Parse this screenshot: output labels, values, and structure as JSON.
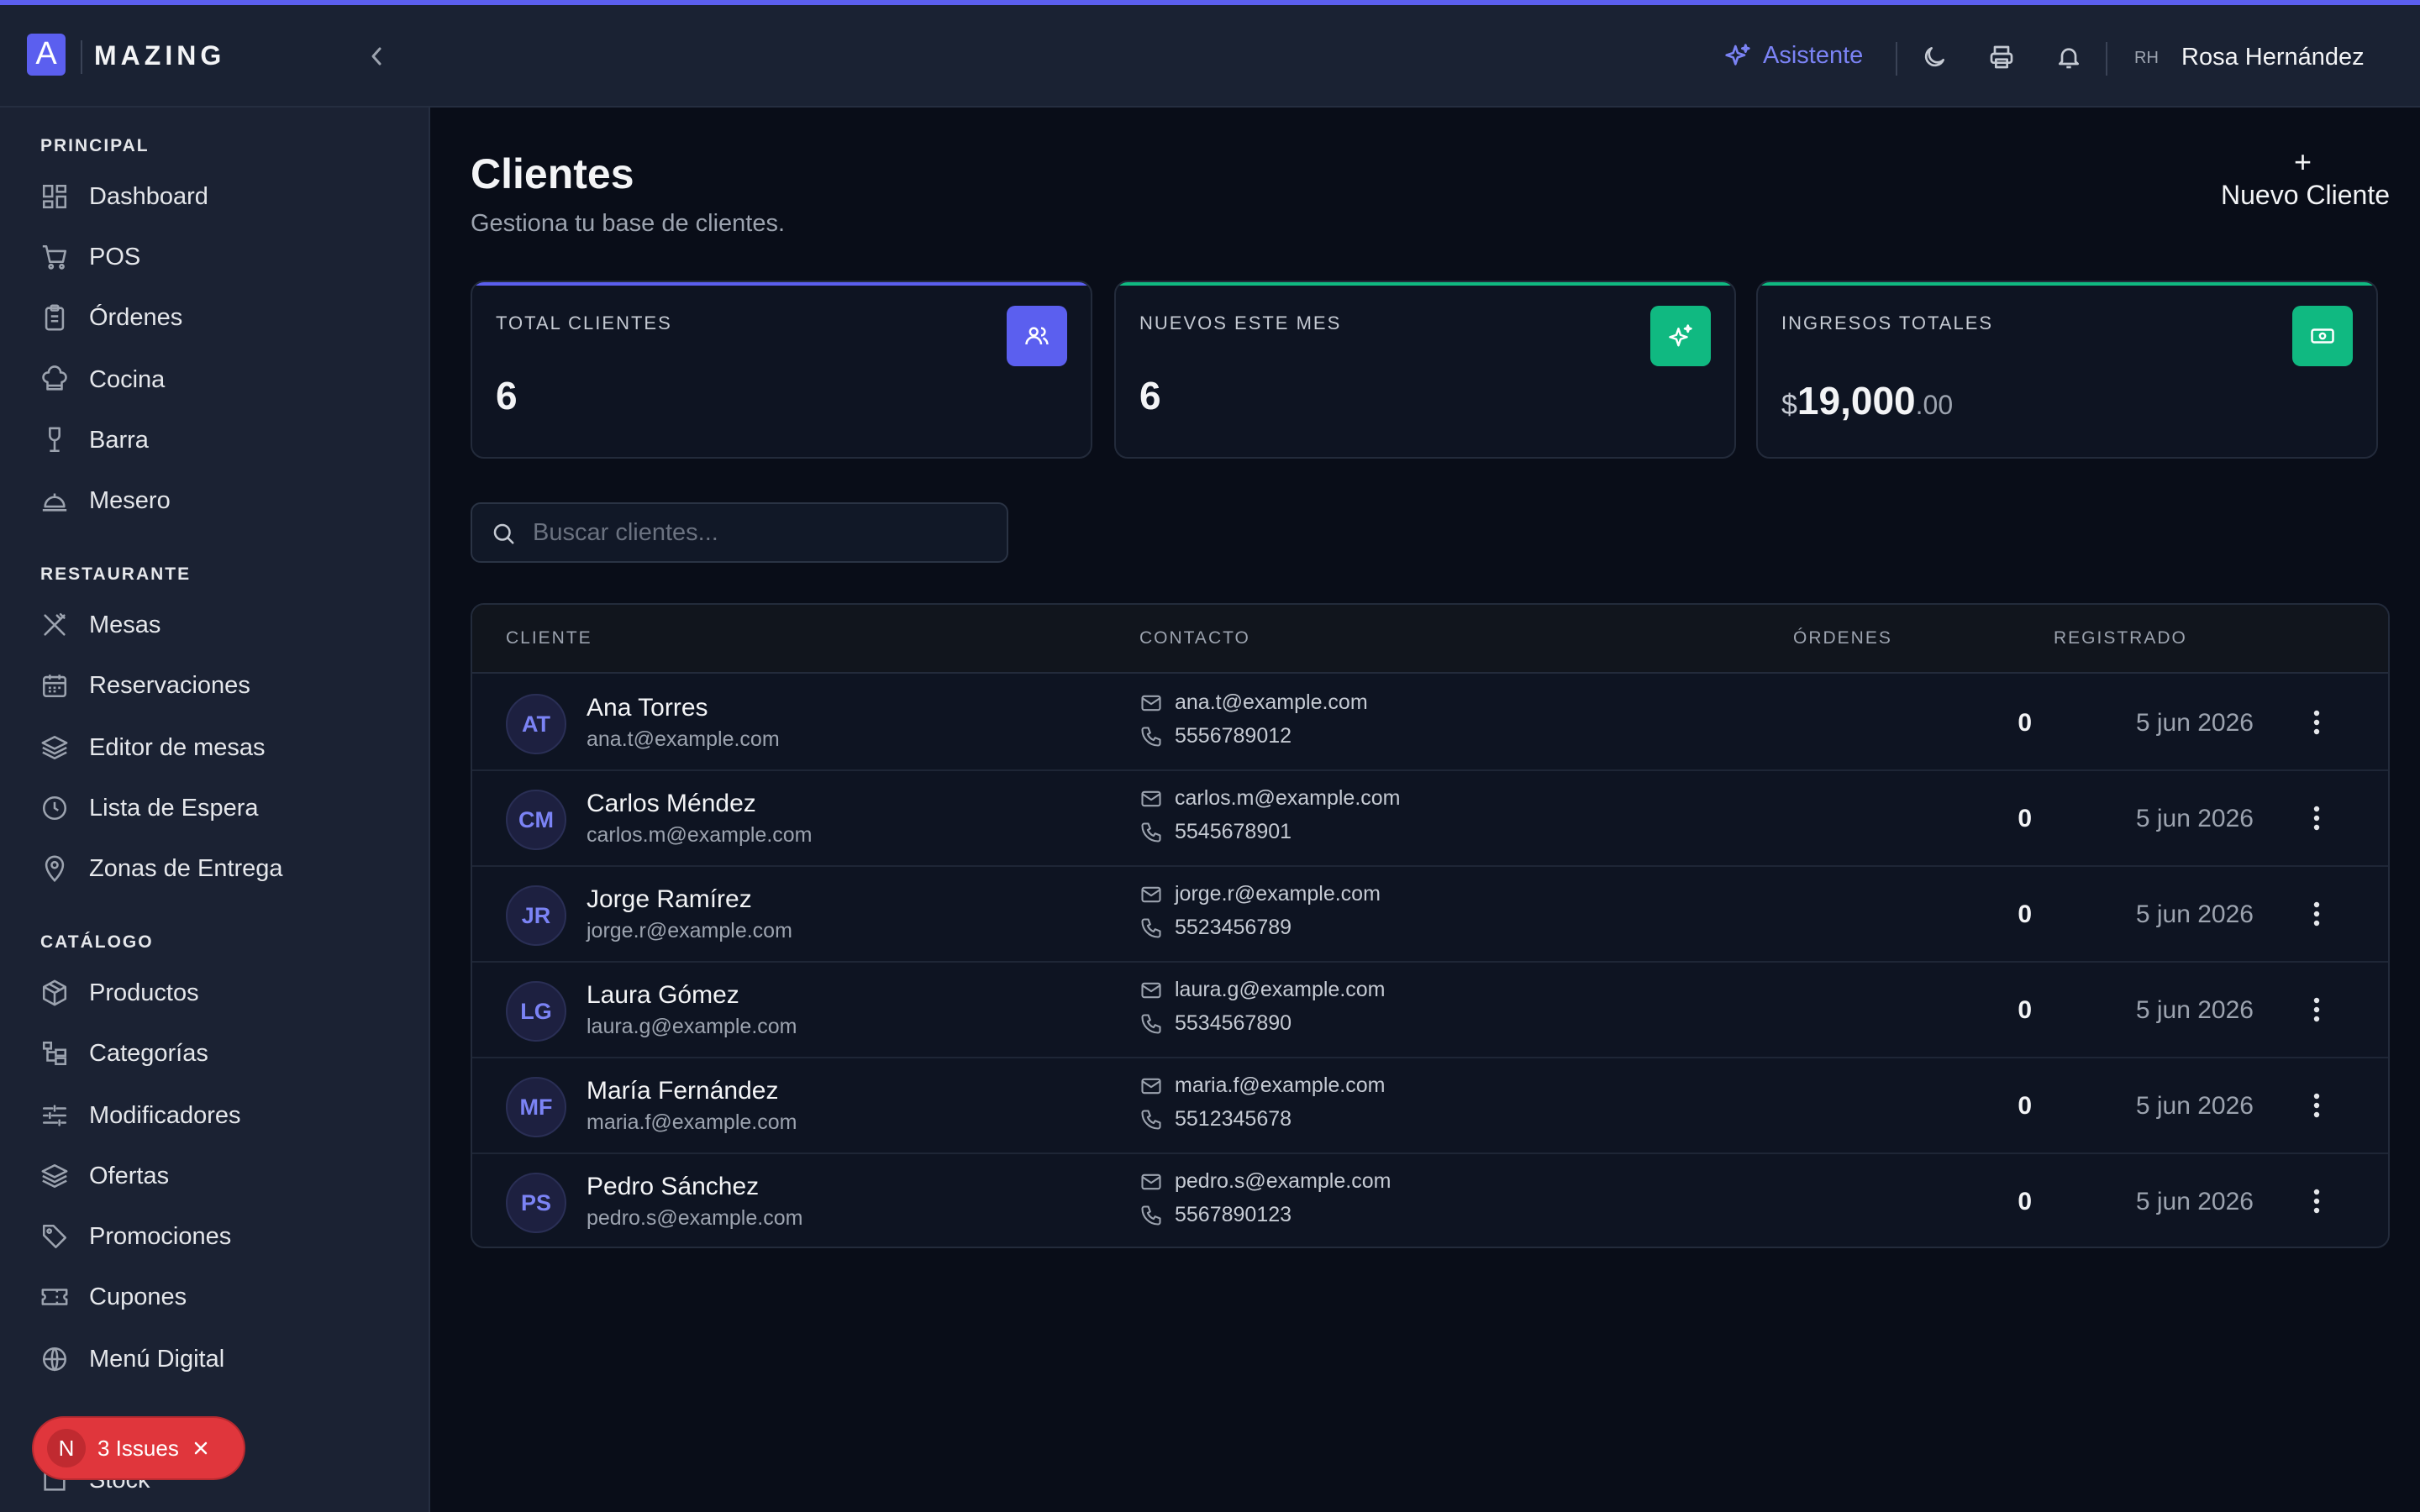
{
  "header": {
    "brand": "MAZING",
    "assistant_label": "Asistente",
    "user_initials": "RH",
    "user_name": "Rosa Hernández"
  },
  "sidebar": {
    "sections": [
      {
        "title": "PRINCIPAL",
        "items": [
          "Dashboard",
          "POS",
          "Órdenes",
          "Cocina",
          "Barra",
          "Mesero"
        ]
      },
      {
        "title": "RESTAURANTE",
        "items": [
          "Mesas",
          "Reservaciones",
          "Editor de mesas",
          "Lista de Espera",
          "Zonas de Entrega"
        ]
      },
      {
        "title": "CATÁLOGO",
        "items": [
          "Productos",
          "Categorías",
          "Modificadores",
          "Ofertas",
          "Promociones",
          "Cupones",
          "Menú Digital"
        ]
      }
    ],
    "partial_item": "Stock"
  },
  "issues_badge": {
    "letter": "N",
    "label": "3 Issues"
  },
  "page": {
    "title": "Clientes",
    "subtitle": "Gestiona tu base de clientes.",
    "new_button": "Nuevo Cliente"
  },
  "stats": {
    "total_label": "TOTAL CLIENTES",
    "total_value": "6",
    "new_label": "NUEVOS ESTE MES",
    "new_value": "6",
    "income_label": "INGRESOS TOTALES",
    "income_currency": "$",
    "income_int": "19,000",
    "income_dec": ".00"
  },
  "search": {
    "placeholder": "Buscar clientes..."
  },
  "table": {
    "headers": {
      "client": "CLIENTE",
      "contact": "CONTACTO",
      "orders": "ÓRDENES",
      "registered": "REGISTRADO"
    },
    "rows": [
      {
        "initials": "AT",
        "name": "Ana Torres",
        "email": "ana.t@example.com",
        "phone": "5556789012",
        "orders": "0",
        "registered": "5 jun 2026"
      },
      {
        "initials": "CM",
        "name": "Carlos Méndez",
        "email": "carlos.m@example.com",
        "phone": "5545678901",
        "orders": "0",
        "registered": "5 jun 2026"
      },
      {
        "initials": "JR",
        "name": "Jorge Ramírez",
        "email": "jorge.r@example.com",
        "phone": "5523456789",
        "orders": "0",
        "registered": "5 jun 2026"
      },
      {
        "initials": "LG",
        "name": "Laura Gómez",
        "email": "laura.g@example.com",
        "phone": "5534567890",
        "orders": "0",
        "registered": "5 jun 2026"
      },
      {
        "initials": "MF",
        "name": "María Fernández",
        "email": "maria.f@example.com",
        "phone": "5512345678",
        "orders": "0",
        "registered": "5 jun 2026"
      },
      {
        "initials": "PS",
        "name": "Pedro Sánchez",
        "email": "pedro.s@example.com",
        "phone": "5567890123",
        "orders": "0",
        "registered": "5 jun 2026"
      }
    ]
  },
  "colors": {
    "accent": "#5b5fef",
    "green": "#10b981",
    "danger": "#e0363c"
  }
}
